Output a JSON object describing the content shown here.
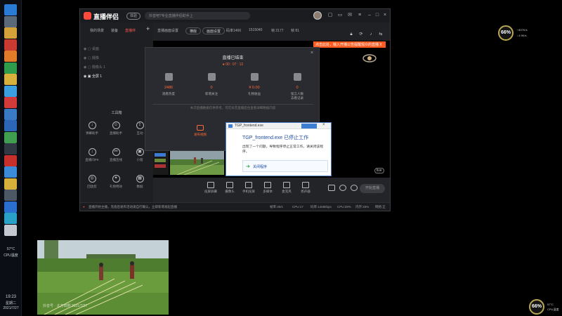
{
  "taskbar": {
    "icons": [
      {
        "name": "ie-icon",
        "color": "#2a7bd6"
      },
      {
        "name": "settings-icon",
        "color": "#5a6a7a"
      },
      {
        "name": "folder-icon",
        "color": "#d3a33a"
      },
      {
        "name": "app-red-icon",
        "color": "#c93b30"
      },
      {
        "name": "app-orange-icon",
        "color": "#e07b2a"
      },
      {
        "name": "app-green-icon",
        "color": "#2e9c4a"
      },
      {
        "name": "chrome-icon",
        "color": "#d7b13b"
      },
      {
        "name": "qq-icon",
        "color": "#3aa0e0"
      },
      {
        "name": "media-icon",
        "color": "#d33b3b"
      },
      {
        "name": "doc-icon",
        "color": "#3a79c4"
      },
      {
        "name": "app-blue-icon",
        "color": "#2d66b8"
      },
      {
        "name": "app-green2-icon",
        "color": "#3f9e4f"
      },
      {
        "name": "app-dark-icon",
        "color": "#303844"
      },
      {
        "name": "shield-icon",
        "color": "#c7302a"
      },
      {
        "name": "edge-icon",
        "color": "#3c8bd8"
      },
      {
        "name": "app-yellow-icon",
        "color": "#d6b03a"
      },
      {
        "name": "network-icon",
        "color": "#4c5866"
      },
      {
        "name": "browser-icon",
        "color": "#2a6ed0"
      },
      {
        "name": "app-cyan-icon",
        "color": "#28a0c8"
      },
      {
        "name": "app-white-icon",
        "color": "#c4c8d0"
      }
    ],
    "temp": "57°C",
    "temp_label": "CPU温度",
    "time": "19:23",
    "weekday": "星期二",
    "date": "2021/7/27"
  },
  "app": {
    "title": "直播伴侣",
    "version": "体验",
    "search_placeholder": "抖音吧?专业直播伴侣助手上",
    "left_tabs": [
      "我的场景",
      "装备",
      "直播伴"
    ],
    "left_tab_active": 2,
    "scenes": [
      "桌面",
      "摄像",
      "摄像头 1",
      "全屏 1"
    ],
    "tools_title": "工具箱",
    "tools": [
      {
        "label": "弹幕助手",
        "icon": "download-icon"
      },
      {
        "label": "直播助手",
        "icon": "person-icon"
      },
      {
        "label": "互动",
        "icon": "share-icon"
      },
      {
        "label": "直播间PK",
        "icon": "download-icon"
      },
      {
        "label": "直播连线",
        "icon": "link-icon"
      },
      {
        "label": "小窗",
        "icon": "window-icon"
      },
      {
        "label": "回放剪",
        "icon": "target-icon"
      },
      {
        "label": "礼物特效",
        "icon": "gift-icon"
      },
      {
        "label": "数据",
        "icon": "calendar-icon"
      }
    ],
    "top_toolbar": {
      "label": "直播画面设置",
      "mode_badge": "横版",
      "resolution_btn": "画面设置",
      "stats": [
        "码率1466",
        "1515040",
        "帧 2177",
        "帧 81"
      ]
    },
    "notify": "点击此处，输入开播公告提醒观众的直播 X",
    "bottom_tools": [
      {
        "label": "投屏屏幕",
        "icon": "screen-icon"
      },
      {
        "label": "摄像头",
        "icon": "camera-icon"
      },
      {
        "label": "手机投屏",
        "icon": "phone-icon"
      },
      {
        "label": "多媒体",
        "icon": "media-icon"
      },
      {
        "label": "麦克风",
        "icon": "mic-icon"
      },
      {
        "label": "扬声器",
        "icon": "speaker-icon"
      }
    ],
    "start_button": "开始直播",
    "status": {
      "warning": "直播开始主播，充值后发布活动请自行确认，立即新增发起直播",
      "items": [
        "帧率:30/s",
        "CPU:17",
        "码率:1466kbps",
        "CPU:29%",
        "内存:33%",
        "网络:正"
      ]
    }
  },
  "end_dialog": {
    "title": "直播已结束",
    "duration": "00 : 07 : 12",
    "stats": [
      {
        "value": "2486",
        "label": "观看热度",
        "icon": "fire-icon"
      },
      {
        "value": "0",
        "label": "新增关注",
        "icon": "heart-icon"
      },
      {
        "value": "¥ 0.00",
        "label": "礼物收益",
        "icon": "gift-icon"
      },
      {
        "value": "0",
        "label": "留言人数\n去看记录",
        "icon": "user-icon"
      }
    ],
    "notice": "本次直播数据仅供参考，可在抖音直播后台查看详细数据内容",
    "action_label": "发布视频"
  },
  "error_dialog": {
    "title": "TGP_frontend.exe",
    "message": "TGP_frontend.exe 已停止工作",
    "detail": "出现了一个问题，导致程序停止正常工作。请关闭该程序。",
    "action": "关闭程序"
  },
  "webcam_preview": {
    "watermark": "抖音号 · 北方田野 2021/7/27"
  },
  "gauges": [
    {
      "value": "66%",
      "lines": [
        "↑ 807K/s",
        "↓ 4.9K/s"
      ]
    },
    {
      "value": "66%",
      "lines": [
        "57°C",
        "CPU温度"
      ]
    }
  ],
  "live_badge": "live",
  "colors": {
    "accent": "#ff5a4a",
    "orange": "#ff6a3a",
    "link": "#1d4ba0"
  }
}
